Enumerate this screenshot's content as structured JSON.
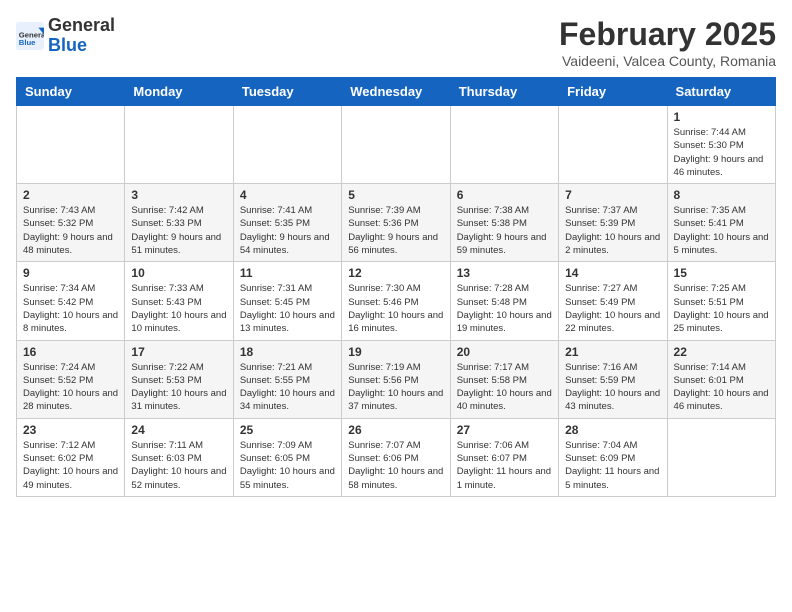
{
  "header": {
    "logo_general": "General",
    "logo_blue": "Blue",
    "title": "February 2025",
    "subtitle": "Vaideeni, Valcea County, Romania"
  },
  "weekdays": [
    "Sunday",
    "Monday",
    "Tuesday",
    "Wednesday",
    "Thursday",
    "Friday",
    "Saturday"
  ],
  "weeks": [
    [
      {
        "day": "",
        "info": ""
      },
      {
        "day": "",
        "info": ""
      },
      {
        "day": "",
        "info": ""
      },
      {
        "day": "",
        "info": ""
      },
      {
        "day": "",
        "info": ""
      },
      {
        "day": "",
        "info": ""
      },
      {
        "day": "1",
        "info": "Sunrise: 7:44 AM\nSunset: 5:30 PM\nDaylight: 9 hours and 46 minutes."
      }
    ],
    [
      {
        "day": "2",
        "info": "Sunrise: 7:43 AM\nSunset: 5:32 PM\nDaylight: 9 hours and 48 minutes."
      },
      {
        "day": "3",
        "info": "Sunrise: 7:42 AM\nSunset: 5:33 PM\nDaylight: 9 hours and 51 minutes."
      },
      {
        "day": "4",
        "info": "Sunrise: 7:41 AM\nSunset: 5:35 PM\nDaylight: 9 hours and 54 minutes."
      },
      {
        "day": "5",
        "info": "Sunrise: 7:39 AM\nSunset: 5:36 PM\nDaylight: 9 hours and 56 minutes."
      },
      {
        "day": "6",
        "info": "Sunrise: 7:38 AM\nSunset: 5:38 PM\nDaylight: 9 hours and 59 minutes."
      },
      {
        "day": "7",
        "info": "Sunrise: 7:37 AM\nSunset: 5:39 PM\nDaylight: 10 hours and 2 minutes."
      },
      {
        "day": "8",
        "info": "Sunrise: 7:35 AM\nSunset: 5:41 PM\nDaylight: 10 hours and 5 minutes."
      }
    ],
    [
      {
        "day": "9",
        "info": "Sunrise: 7:34 AM\nSunset: 5:42 PM\nDaylight: 10 hours and 8 minutes."
      },
      {
        "day": "10",
        "info": "Sunrise: 7:33 AM\nSunset: 5:43 PM\nDaylight: 10 hours and 10 minutes."
      },
      {
        "day": "11",
        "info": "Sunrise: 7:31 AM\nSunset: 5:45 PM\nDaylight: 10 hours and 13 minutes."
      },
      {
        "day": "12",
        "info": "Sunrise: 7:30 AM\nSunset: 5:46 PM\nDaylight: 10 hours and 16 minutes."
      },
      {
        "day": "13",
        "info": "Sunrise: 7:28 AM\nSunset: 5:48 PM\nDaylight: 10 hours and 19 minutes."
      },
      {
        "day": "14",
        "info": "Sunrise: 7:27 AM\nSunset: 5:49 PM\nDaylight: 10 hours and 22 minutes."
      },
      {
        "day": "15",
        "info": "Sunrise: 7:25 AM\nSunset: 5:51 PM\nDaylight: 10 hours and 25 minutes."
      }
    ],
    [
      {
        "day": "16",
        "info": "Sunrise: 7:24 AM\nSunset: 5:52 PM\nDaylight: 10 hours and 28 minutes."
      },
      {
        "day": "17",
        "info": "Sunrise: 7:22 AM\nSunset: 5:53 PM\nDaylight: 10 hours and 31 minutes."
      },
      {
        "day": "18",
        "info": "Sunrise: 7:21 AM\nSunset: 5:55 PM\nDaylight: 10 hours and 34 minutes."
      },
      {
        "day": "19",
        "info": "Sunrise: 7:19 AM\nSunset: 5:56 PM\nDaylight: 10 hours and 37 minutes."
      },
      {
        "day": "20",
        "info": "Sunrise: 7:17 AM\nSunset: 5:58 PM\nDaylight: 10 hours and 40 minutes."
      },
      {
        "day": "21",
        "info": "Sunrise: 7:16 AM\nSunset: 5:59 PM\nDaylight: 10 hours and 43 minutes."
      },
      {
        "day": "22",
        "info": "Sunrise: 7:14 AM\nSunset: 6:01 PM\nDaylight: 10 hours and 46 minutes."
      }
    ],
    [
      {
        "day": "23",
        "info": "Sunrise: 7:12 AM\nSunset: 6:02 PM\nDaylight: 10 hours and 49 minutes."
      },
      {
        "day": "24",
        "info": "Sunrise: 7:11 AM\nSunset: 6:03 PM\nDaylight: 10 hours and 52 minutes."
      },
      {
        "day": "25",
        "info": "Sunrise: 7:09 AM\nSunset: 6:05 PM\nDaylight: 10 hours and 55 minutes."
      },
      {
        "day": "26",
        "info": "Sunrise: 7:07 AM\nSunset: 6:06 PM\nDaylight: 10 hours and 58 minutes."
      },
      {
        "day": "27",
        "info": "Sunrise: 7:06 AM\nSunset: 6:07 PM\nDaylight: 11 hours and 1 minute."
      },
      {
        "day": "28",
        "info": "Sunrise: 7:04 AM\nSunset: 6:09 PM\nDaylight: 11 hours and 5 minutes."
      },
      {
        "day": "",
        "info": ""
      }
    ]
  ]
}
